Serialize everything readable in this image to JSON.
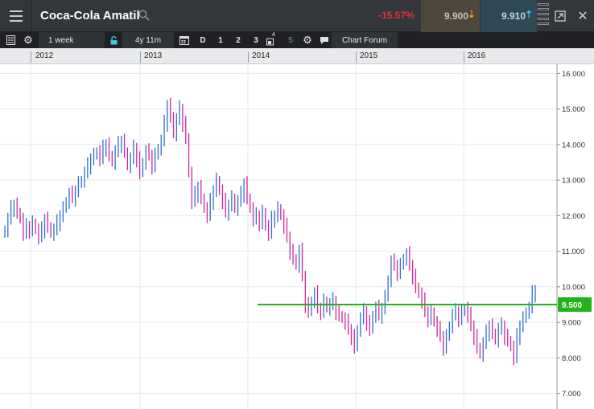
{
  "header": {
    "title": "Coca-Cola Amatil",
    "change": "-15.57%",
    "sell_price": "9.900",
    "buy_price": "9.910",
    "colors": {
      "down": "#e8303a",
      "sell_arrow": "#f39a1d",
      "buy_arrow": "#38c8f0"
    }
  },
  "toolbar": {
    "interval": "1 week",
    "range": "4y 11m",
    "period_d": "D",
    "period_1": "1",
    "period_2": "2",
    "period_3": "3",
    "period_4": "4",
    "period_5": "5",
    "forum": "Chart Forum"
  },
  "timeline": {
    "years": [
      "2012",
      "2013",
      "2014",
      "2015",
      "2016"
    ]
  },
  "chart_data": {
    "type": "ohlc",
    "x_unit": "week",
    "x_start": "2011-11",
    "x_end": "2016-09",
    "ylim": [
      6.8,
      16.1
    ],
    "yticks": [
      "7.000",
      "8.000",
      "9.000",
      "10.000",
      "11.000",
      "12.000",
      "13.000",
      "14.000",
      "15.000",
      "16.000"
    ],
    "grid": true,
    "colors": {
      "up": "#2f6fd1",
      "down": "#d0269c",
      "level": "#22b21a"
    },
    "horizontal_line": {
      "value": 9.5,
      "label": "9.500",
      "start": "2014"
    },
    "weekly_close": [
      11.6,
      11.9,
      12.2,
      12.3,
      12.1,
      11.9,
      11.5,
      11.7,
      11.6,
      11.8,
      11.6,
      11.4,
      11.6,
      11.9,
      11.7,
      11.5,
      11.6,
      11.8,
      12.0,
      12.2,
      12.4,
      12.6,
      12.5,
      12.7,
      12.9,
      13.0,
      13.2,
      13.4,
      13.6,
      13.7,
      13.8,
      13.6,
      13.9,
      14.0,
      13.7,
      13.5,
      13.8,
      14.0,
      14.1,
      13.8,
      13.4,
      13.6,
      13.9,
      13.6,
      13.2,
      13.5,
      13.8,
      13.7,
      13.4,
      13.7,
      13.9,
      14.1,
      14.6,
      15.1,
      14.8,
      14.3,
      14.7,
      15.0,
      14.6,
      14.2,
      13.2,
      12.4,
      12.6,
      12.8,
      12.5,
      12.2,
      12.0,
      12.4,
      12.7,
      13.0,
      12.7,
      12.4,
      12.1,
      12.3,
      12.5,
      12.2,
      12.4,
      12.6,
      12.9,
      12.5,
      12.2,
      11.9,
      12.0,
      11.8,
      12.1,
      11.7,
      11.5,
      11.9,
      12.0,
      12.2,
      12.0,
      11.7,
      11.4,
      11.0,
      10.8,
      10.6,
      11.0,
      10.3,
      9.5,
      9.3,
      9.6,
      9.8,
      9.4,
      9.3,
      9.6,
      9.4,
      9.5,
      9.6,
      9.3,
      9.2,
      9.1,
      9.0,
      8.8,
      8.6,
      8.3,
      8.8,
      9.1,
      9.3,
      9.0,
      8.8,
      9.2,
      9.4,
      9.2,
      9.4,
      9.7,
      10.2,
      10.7,
      10.6,
      10.4,
      10.6,
      10.8,
      10.9,
      10.6,
      10.3,
      10.0,
      9.8,
      9.6,
      9.3,
      9.1,
      9.3,
      9.0,
      8.8,
      8.6,
      8.3,
      8.6,
      8.9,
      9.2,
      9.3,
      9.1,
      9.3,
      9.4,
      9.2,
      8.9,
      8.6,
      8.3,
      8.1,
      8.4,
      8.7,
      8.9,
      8.7,
      8.5,
      8.8,
      8.9,
      8.6,
      8.5,
      8.3,
      8.0,
      8.6,
      8.9,
      9.1,
      9.3,
      9.4,
      9.8,
      9.9
    ]
  }
}
